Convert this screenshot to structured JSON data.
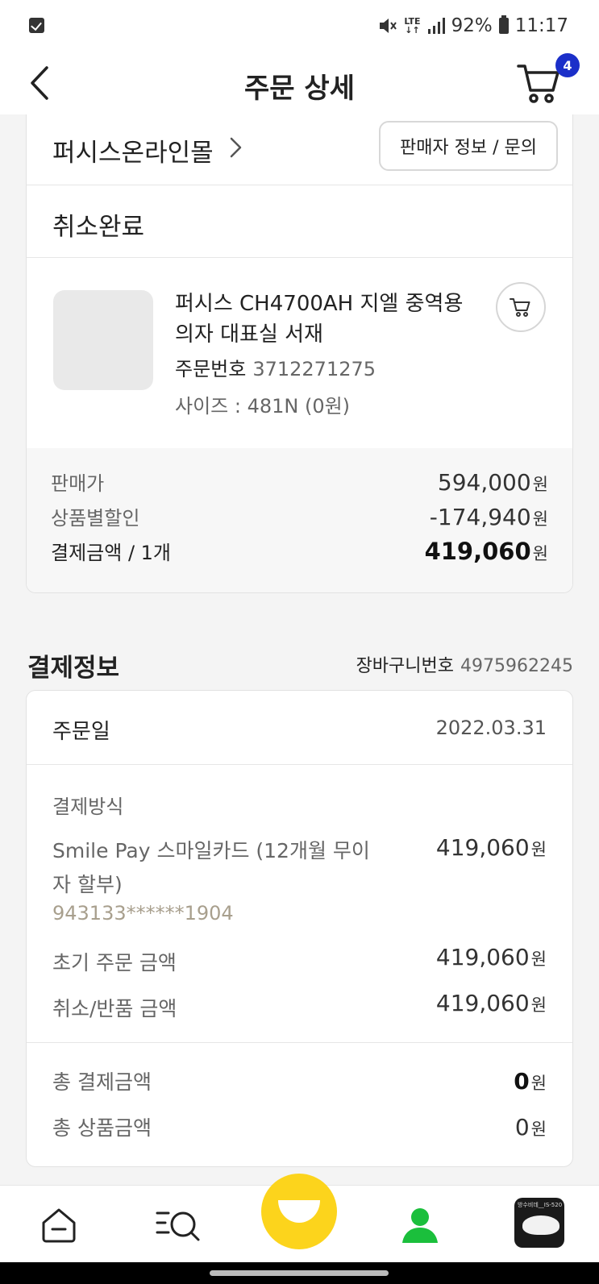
{
  "status_bar": {
    "network": "LTE",
    "battery": "92%",
    "time": "11:17"
  },
  "header": {
    "title": "주문 상세",
    "cart_badge": "4"
  },
  "order": {
    "seller_name": "퍼시스온라인몰",
    "seller_button": "판매자 정보 / 문의",
    "status": "취소완료",
    "product_name": "퍼시스 CH4700AH 지엘 중역용 의자 대표실 서재",
    "order_no_label": "주문번호",
    "order_no": "3712271275",
    "option": "사이즈 : 481N (0원)",
    "prices": [
      {
        "label": "판매가",
        "value": "594,000",
        "unit": "원"
      },
      {
        "label": "상품별할인",
        "value": "-174,940",
        "unit": "원"
      },
      {
        "label": "결제금액 / 1개",
        "value": "419,060",
        "unit": "원"
      }
    ]
  },
  "payment": {
    "title": "결제정보",
    "cart_no_label": "장바구니번호",
    "cart_no": "4975962245",
    "order_date_label": "주문일",
    "order_date": "2022.03.31",
    "method_label": "결제방식",
    "method_desc": "Smile Pay 스마일카드 (12개월 무이자 할부)",
    "method_amount": "419,060",
    "card_no": "943133******1904",
    "initial_label": "초기 주문 금액",
    "initial_amount": "419,060",
    "cancel_label": "취소/반품 금액",
    "cancel_amount": "419,060",
    "total_pay_label": "총 결제금액",
    "total_pay": "0",
    "total_product_label": "총 상품금액",
    "total_product": "0",
    "unit": "원"
  },
  "bottom_nav": {
    "items": [
      "home-icon",
      "search-list-icon",
      "smile-icon",
      "my-page-icon",
      "recent-item-thumbnail"
    ],
    "thumb_text": "방수비데__IS-520"
  },
  "colors": {
    "accent_yellow": "#fcd41c",
    "badge_blue": "#1b2fc9",
    "profile_green": "#1bbf3c",
    "card_number": "#a89f8d"
  }
}
